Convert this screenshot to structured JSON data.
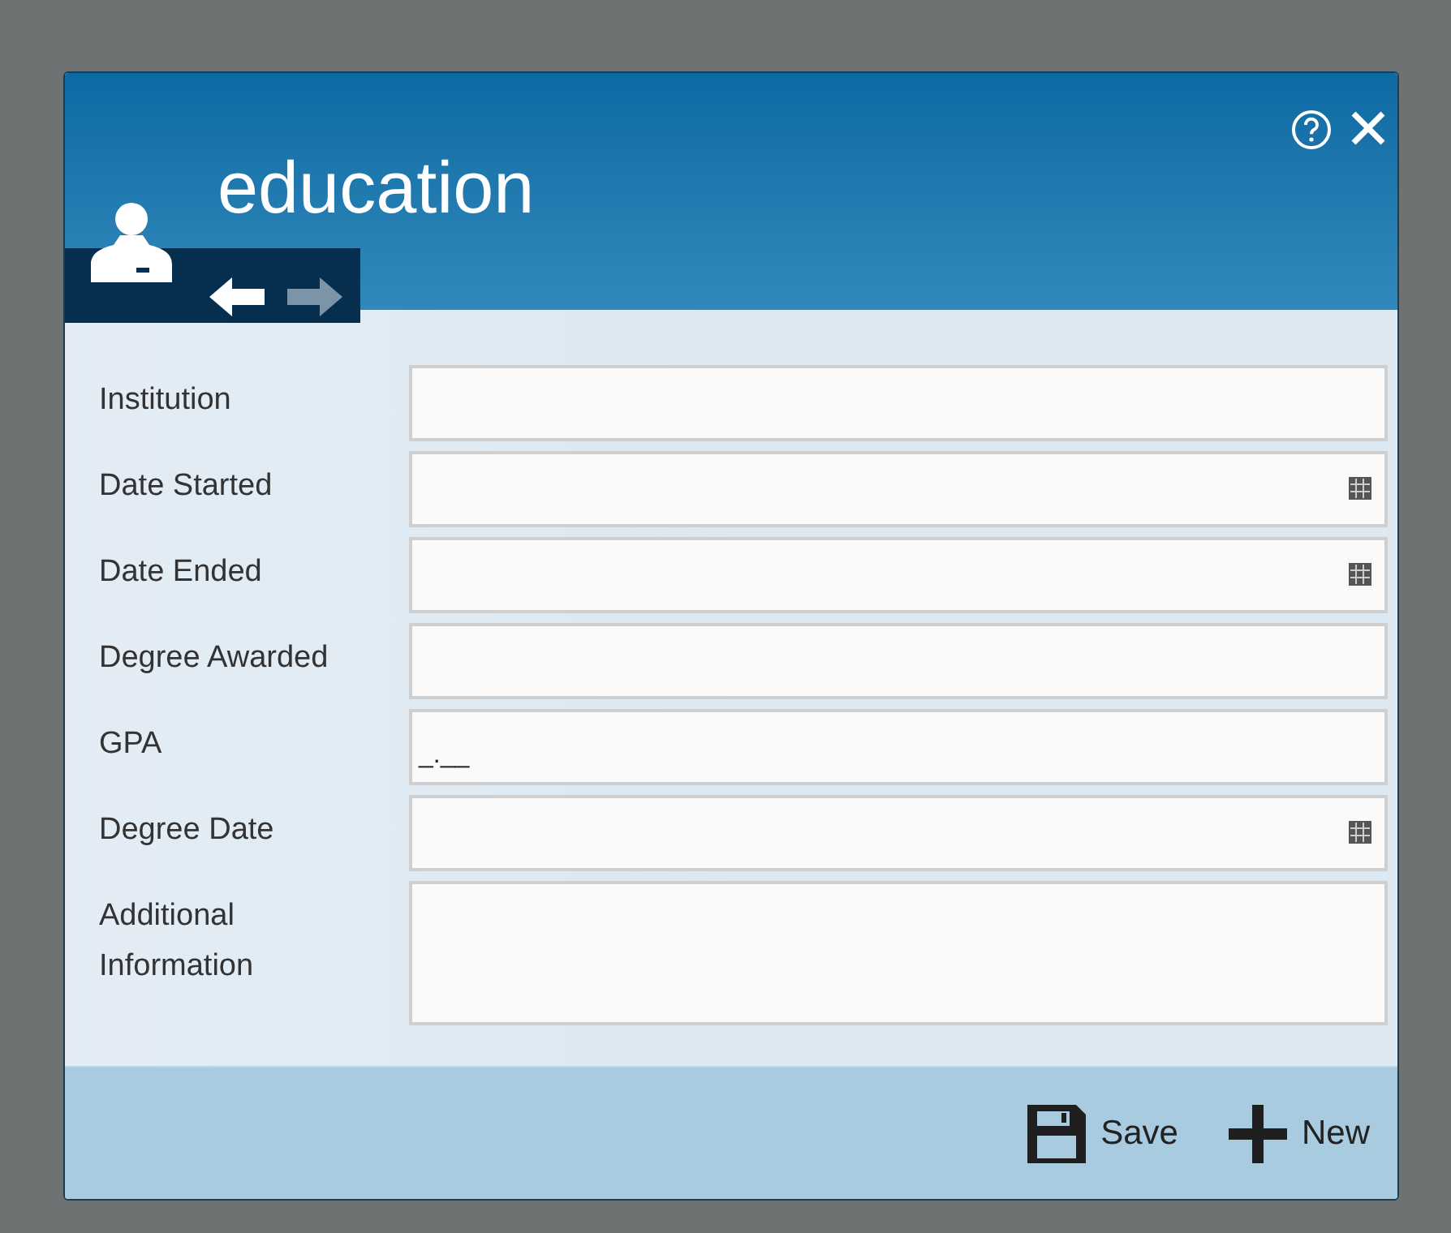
{
  "dialog": {
    "title": "education",
    "nav": [
      {
        "kind": "back",
        "disabled": false
      },
      {
        "kind": "forward",
        "disabled": true
      }
    ]
  },
  "fields": [
    {
      "label": "Institution",
      "kind": "text"
    },
    {
      "label": "Date Started",
      "kind": "date"
    },
    {
      "label": "Date Ended",
      "kind": "date"
    },
    {
      "label": "Degree Awarded",
      "kind": "text"
    },
    {
      "label": "GPA",
      "kind": "text",
      "value": "_.__"
    },
    {
      "label": "Degree Date",
      "kind": "date"
    },
    {
      "label": "Additional Information",
      "kind": "multiline"
    }
  ],
  "footer": {
    "buttons": [
      {
        "label": "Save",
        "kind": "save"
      },
      {
        "label": "New",
        "kind": "new"
      }
    ]
  }
}
